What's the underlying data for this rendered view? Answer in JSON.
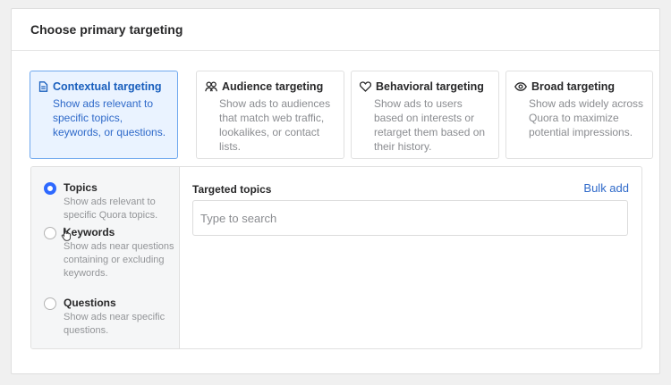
{
  "header": {
    "title": "Choose primary targeting"
  },
  "targeting_cards": [
    {
      "title": "Contextual targeting",
      "description": "Show ads relevant to specific topics, keywords, or questions.",
      "icon": "document-icon",
      "selected": true
    },
    {
      "title": "Audience targeting",
      "description": "Show ads to audiences that match web traffic, lookalikes, or contact lists.",
      "icon": "people-icon",
      "selected": false
    },
    {
      "title": "Behavioral targeting",
      "description": "Show ads to users based on interests or retarget them based on their history.",
      "icon": "heart-icon",
      "selected": false
    },
    {
      "title": "Broad targeting",
      "description": "Show ads widely across Quora to maximize potential impressions.",
      "icon": "eye-icon",
      "selected": false
    }
  ],
  "options": [
    {
      "title": "Topics",
      "description": "Show ads relevant to specific Quora topics.",
      "checked": true
    },
    {
      "title": "Keywords",
      "description": "Show ads near questions containing or excluding keywords.",
      "checked": false
    },
    {
      "title": "Questions",
      "description": "Show ads near specific questions.",
      "checked": false
    }
  ],
  "content": {
    "label": "Targeted topics",
    "bulk_add": "Bulk add",
    "search_placeholder": "Type to search"
  },
  "colors": {
    "accent": "#2e69ff",
    "selected_bg": "#eaf3ff",
    "link": "#2e69c9"
  }
}
